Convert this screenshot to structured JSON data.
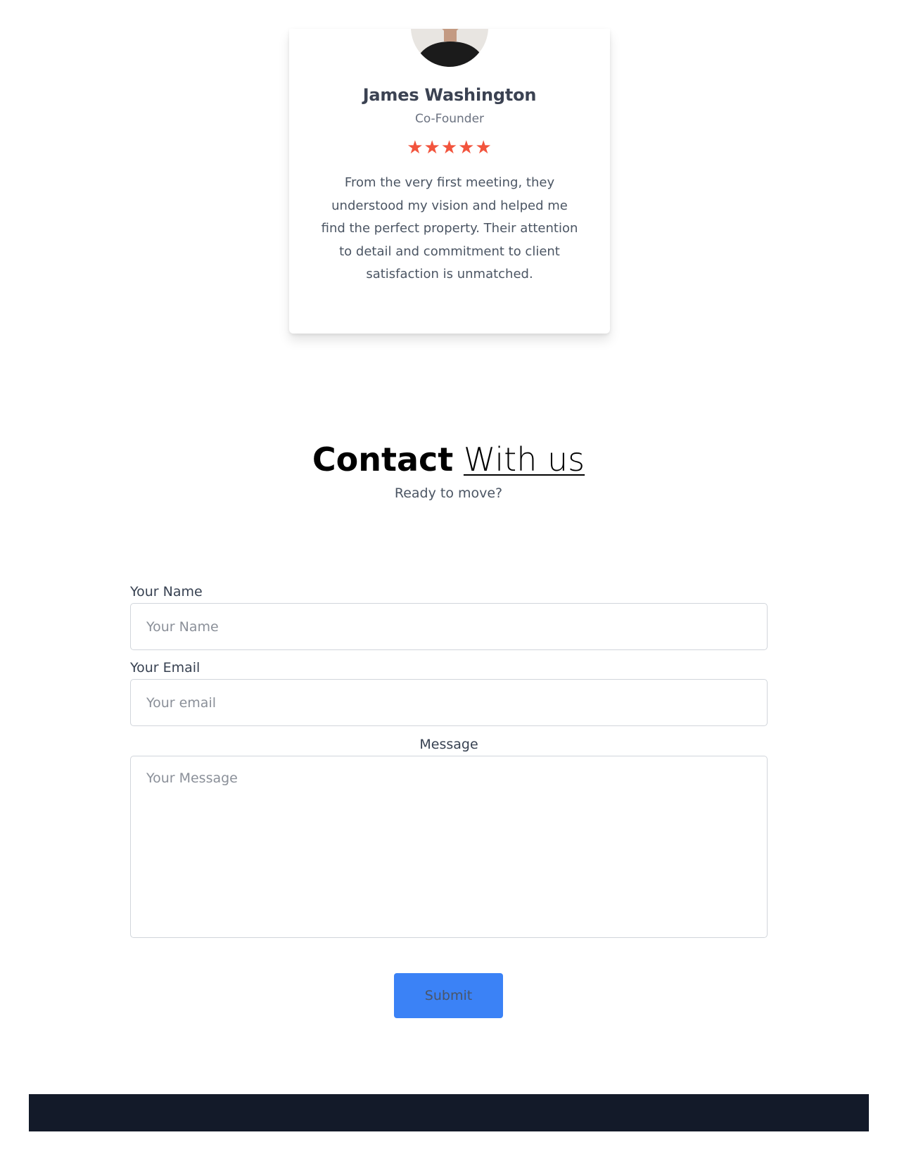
{
  "testimonial": {
    "avatar_icon": "person-photo-icon",
    "name": "James Washington",
    "role": "Co-Founder",
    "rating": 5,
    "stars": "★★★★★",
    "star_color": "#f2543d",
    "quote": "From the very first meeting, they understood my vision and helped me find the perfect property. Their attention to detail and commitment to client satisfaction is unmatched."
  },
  "contact": {
    "title_bold": "Contact",
    "title_light": "With us",
    "subtitle": "Ready to move?"
  },
  "form": {
    "name_label": "Your Name",
    "name_placeholder": "Your Name",
    "name_value": "",
    "email_label": "Your Email",
    "email_placeholder": "Your email",
    "email_value": "",
    "message_label": "Message",
    "message_placeholder": "Your Message",
    "message_value": "",
    "submit_label": "Submit"
  },
  "colors": {
    "accent": "#3b82f6",
    "footer": "#131a29"
  }
}
